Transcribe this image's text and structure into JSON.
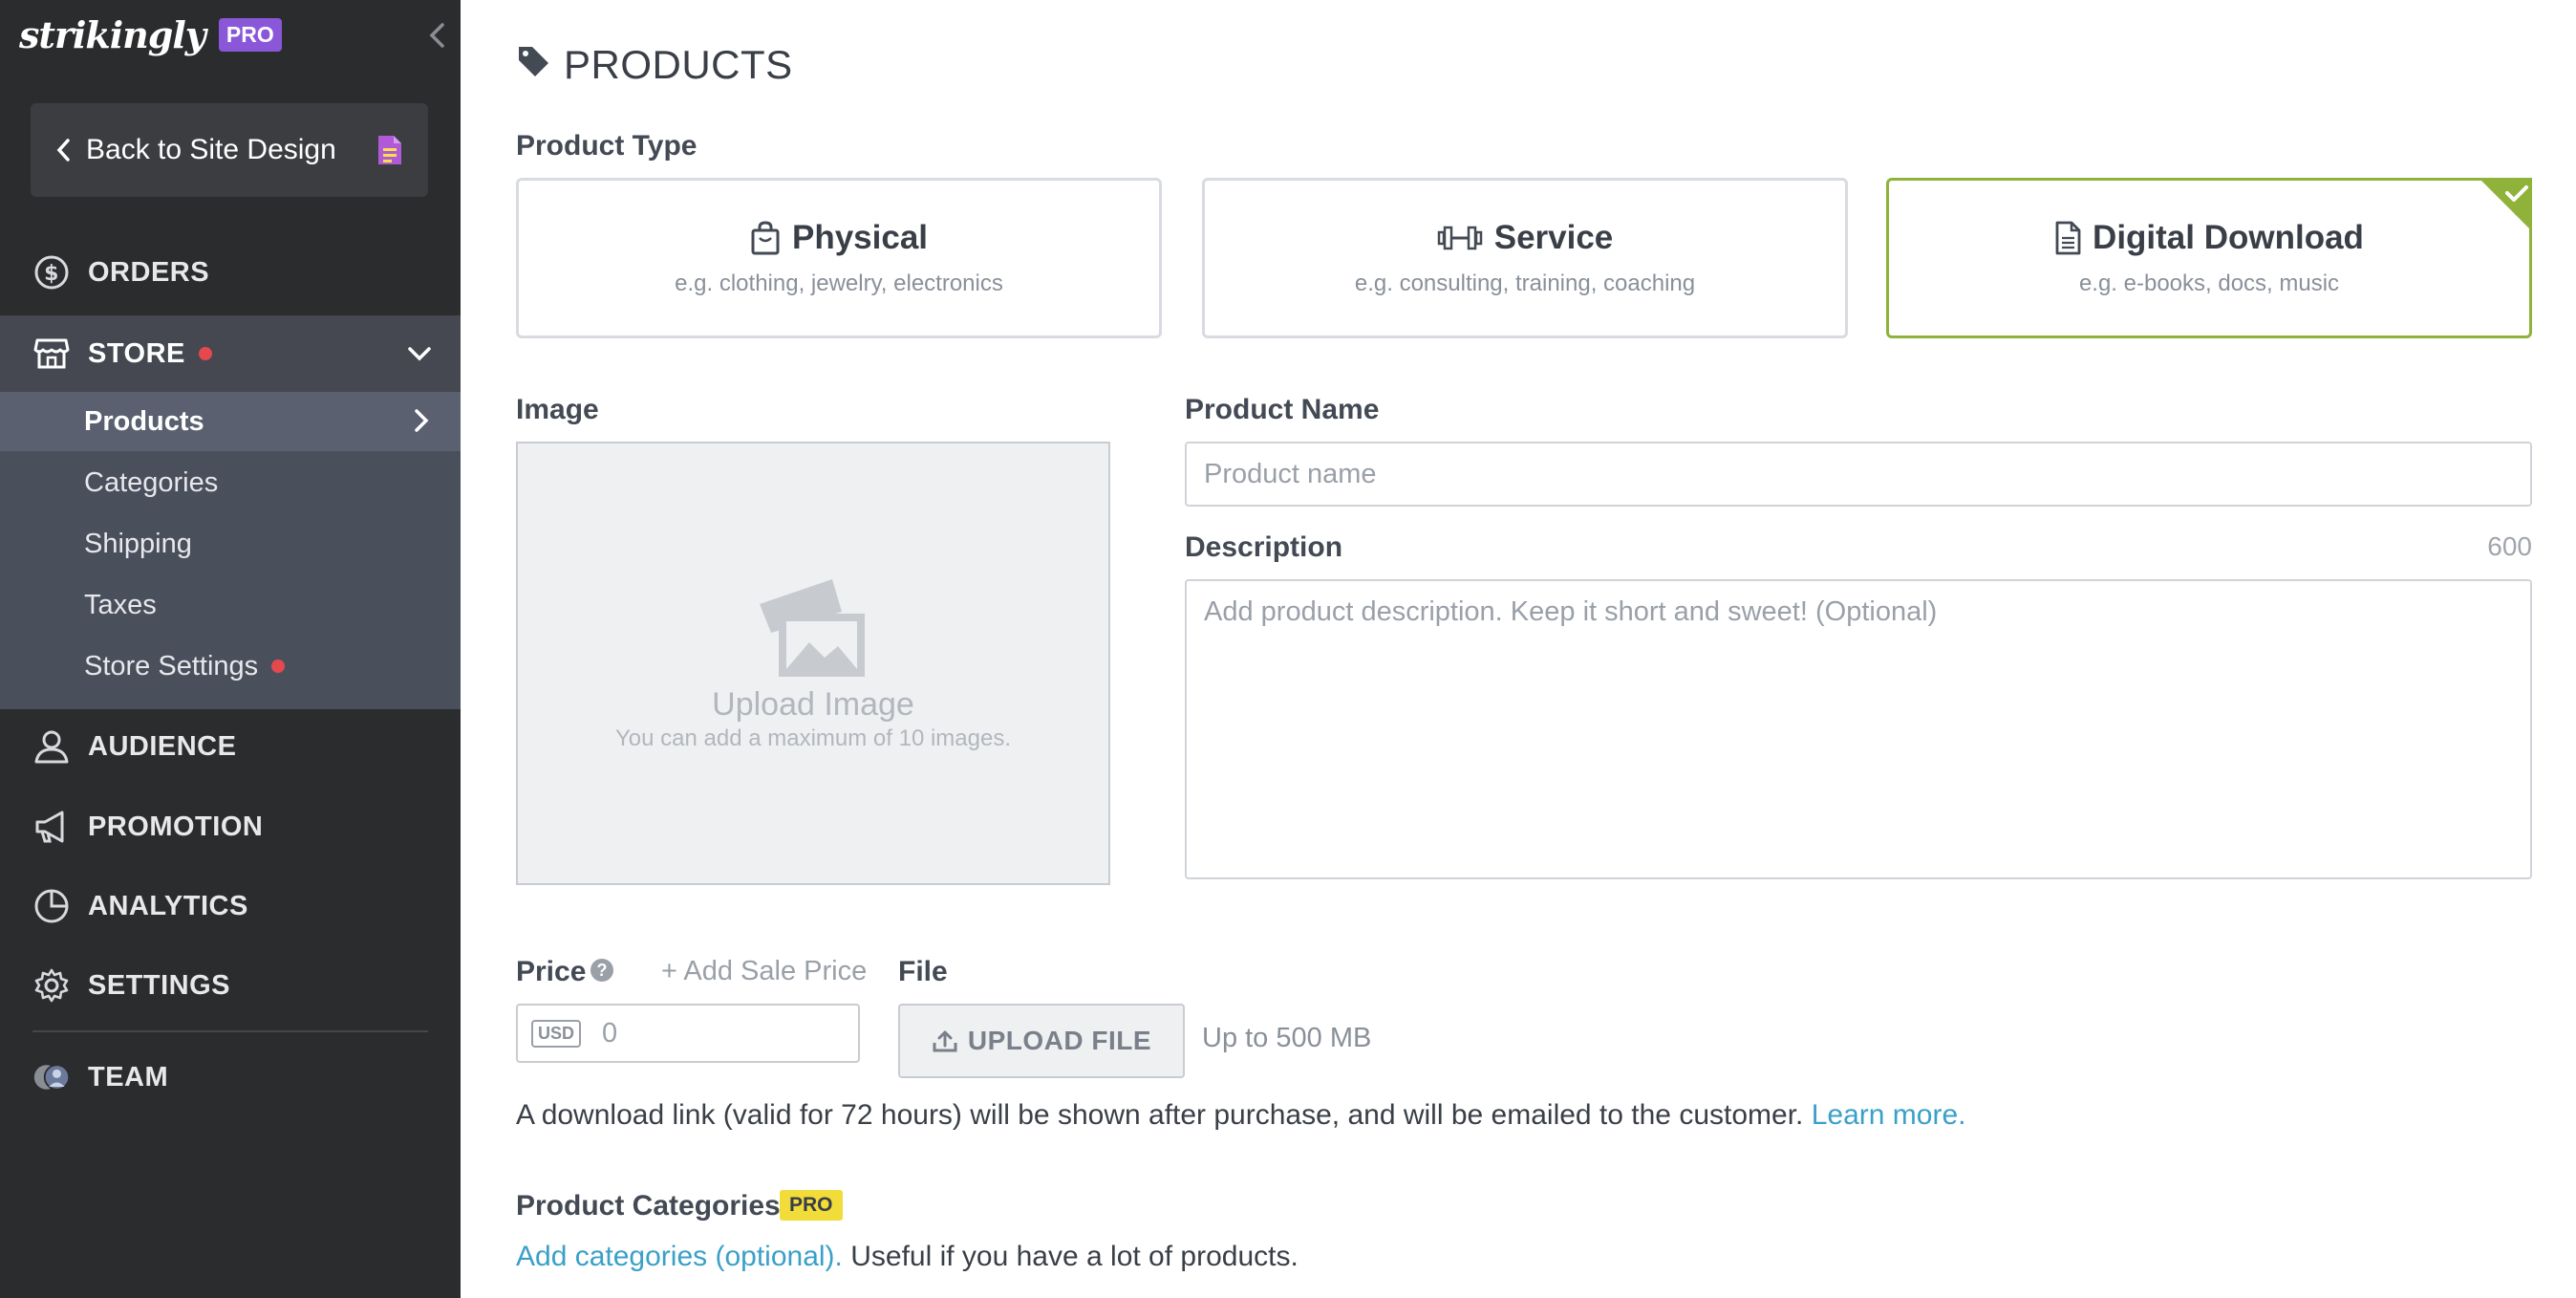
{
  "sidebar": {
    "brand": "strikingly",
    "brand_badge": "PRO",
    "back_label": "Back to Site Design",
    "nav": {
      "orders": "ORDERS",
      "store": "STORE",
      "audience": "AUDIENCE",
      "promotion": "PROMOTION",
      "analytics": "ANALYTICS",
      "settings": "SETTINGS",
      "team": "TEAM"
    },
    "store_sub": {
      "products": "Products",
      "categories": "Categories",
      "shipping": "Shipping",
      "taxes": "Taxes",
      "store_settings": "Store Settings"
    }
  },
  "main": {
    "title": "PRODUCTS",
    "product_type_label": "Product Type",
    "types": [
      {
        "title": "Physical",
        "sub": "e.g. clothing, jewelry, electronics"
      },
      {
        "title": "Service",
        "sub": "e.g. consulting, training, coaching"
      },
      {
        "title": "Digital Download",
        "sub": "e.g. e-books, docs, music"
      }
    ],
    "image_label": "Image",
    "upload_title": "Upload Image",
    "upload_sub": "You can add a maximum of 10 images.",
    "product_name_label": "Product Name",
    "product_name_placeholder": "Product name",
    "description_label": "Description",
    "description_count": "600",
    "description_placeholder": "Add product description. Keep it short and sweet! (Optional)",
    "price_label": "Price",
    "help_glyph": "?",
    "add_sale_price": "+ Add Sale Price",
    "currency": "USD",
    "price_value": "0",
    "file_label": "File",
    "upload_file": "UPLOAD FILE",
    "file_limit": "Up to 500 MB",
    "download_note": "A download link (valid for 72 hours) will be shown after purchase, and will be emailed to the customer.",
    "learn_more": "Learn more.",
    "categories_label": "Product Categories",
    "categories_badge": "PRO",
    "add_categories_link": "Add categories (optional).",
    "add_categories_rest": "Useful if you have a lot of products."
  },
  "colors": {
    "sidebar_bg": "#2b2c2e",
    "selected_border": "#8fb33a",
    "link": "#3aa0c8",
    "pro_purple": "#8a57d8",
    "pro_yellow": "#f2dc3a",
    "notify_red": "#e5484d"
  },
  "icons": [
    "chevron-left-icon",
    "document-icon",
    "dollar-circle-icon",
    "store-icon",
    "chevron-down-icon",
    "chevron-right-icon",
    "user-icon",
    "megaphone-icon",
    "pie-chart-icon",
    "gear-icon",
    "team-avatar-icon",
    "tag-icon",
    "shopping-bag-icon",
    "dumbbell-icon",
    "file-icon",
    "checkmark-icon",
    "image-placeholder-icon",
    "help-icon",
    "upload-icon"
  ]
}
